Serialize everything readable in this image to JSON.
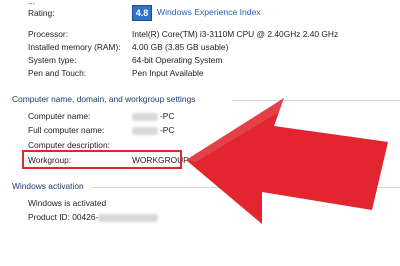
{
  "top_cropped_text": "...",
  "rating": {
    "label": "Rating:",
    "score": "4.8",
    "link": "Windows Experience Index"
  },
  "system": [
    {
      "label": "Processor:",
      "value": "Intel(R) Core(TM) i3-3110M CPU @ 2.40GHz   2.40 GHz"
    },
    {
      "label": "Installed memory (RAM):",
      "value": "4.00 GB (3.85 GB usable)"
    },
    {
      "label": "System type:",
      "value": "64-bit Operating System"
    },
    {
      "label": "Pen and Touch:",
      "value": "Pen Input Available"
    }
  ],
  "computer_section": {
    "header": "Computer name, domain, and workgroup settings",
    "computer_name_label": "Computer name:",
    "computer_name_value": "-PC",
    "full_name_label": "Full computer name:",
    "full_name_value": "-PC",
    "description_label": "Computer description:",
    "workgroup_label": "Workgroup:",
    "workgroup_value": "WORKGROUP"
  },
  "activation_section": {
    "header": "Windows activation",
    "status": "Windows is activated",
    "product_id_label": "Product ID: 00426-"
  },
  "colors": {
    "highlight": "#e2252f",
    "arrow": "#e2252f",
    "link": "#1f63b5",
    "section_header": "#1e3b6e"
  },
  "icons": [
    "windows-experience-index-badge",
    "red-pointer-arrow"
  ]
}
